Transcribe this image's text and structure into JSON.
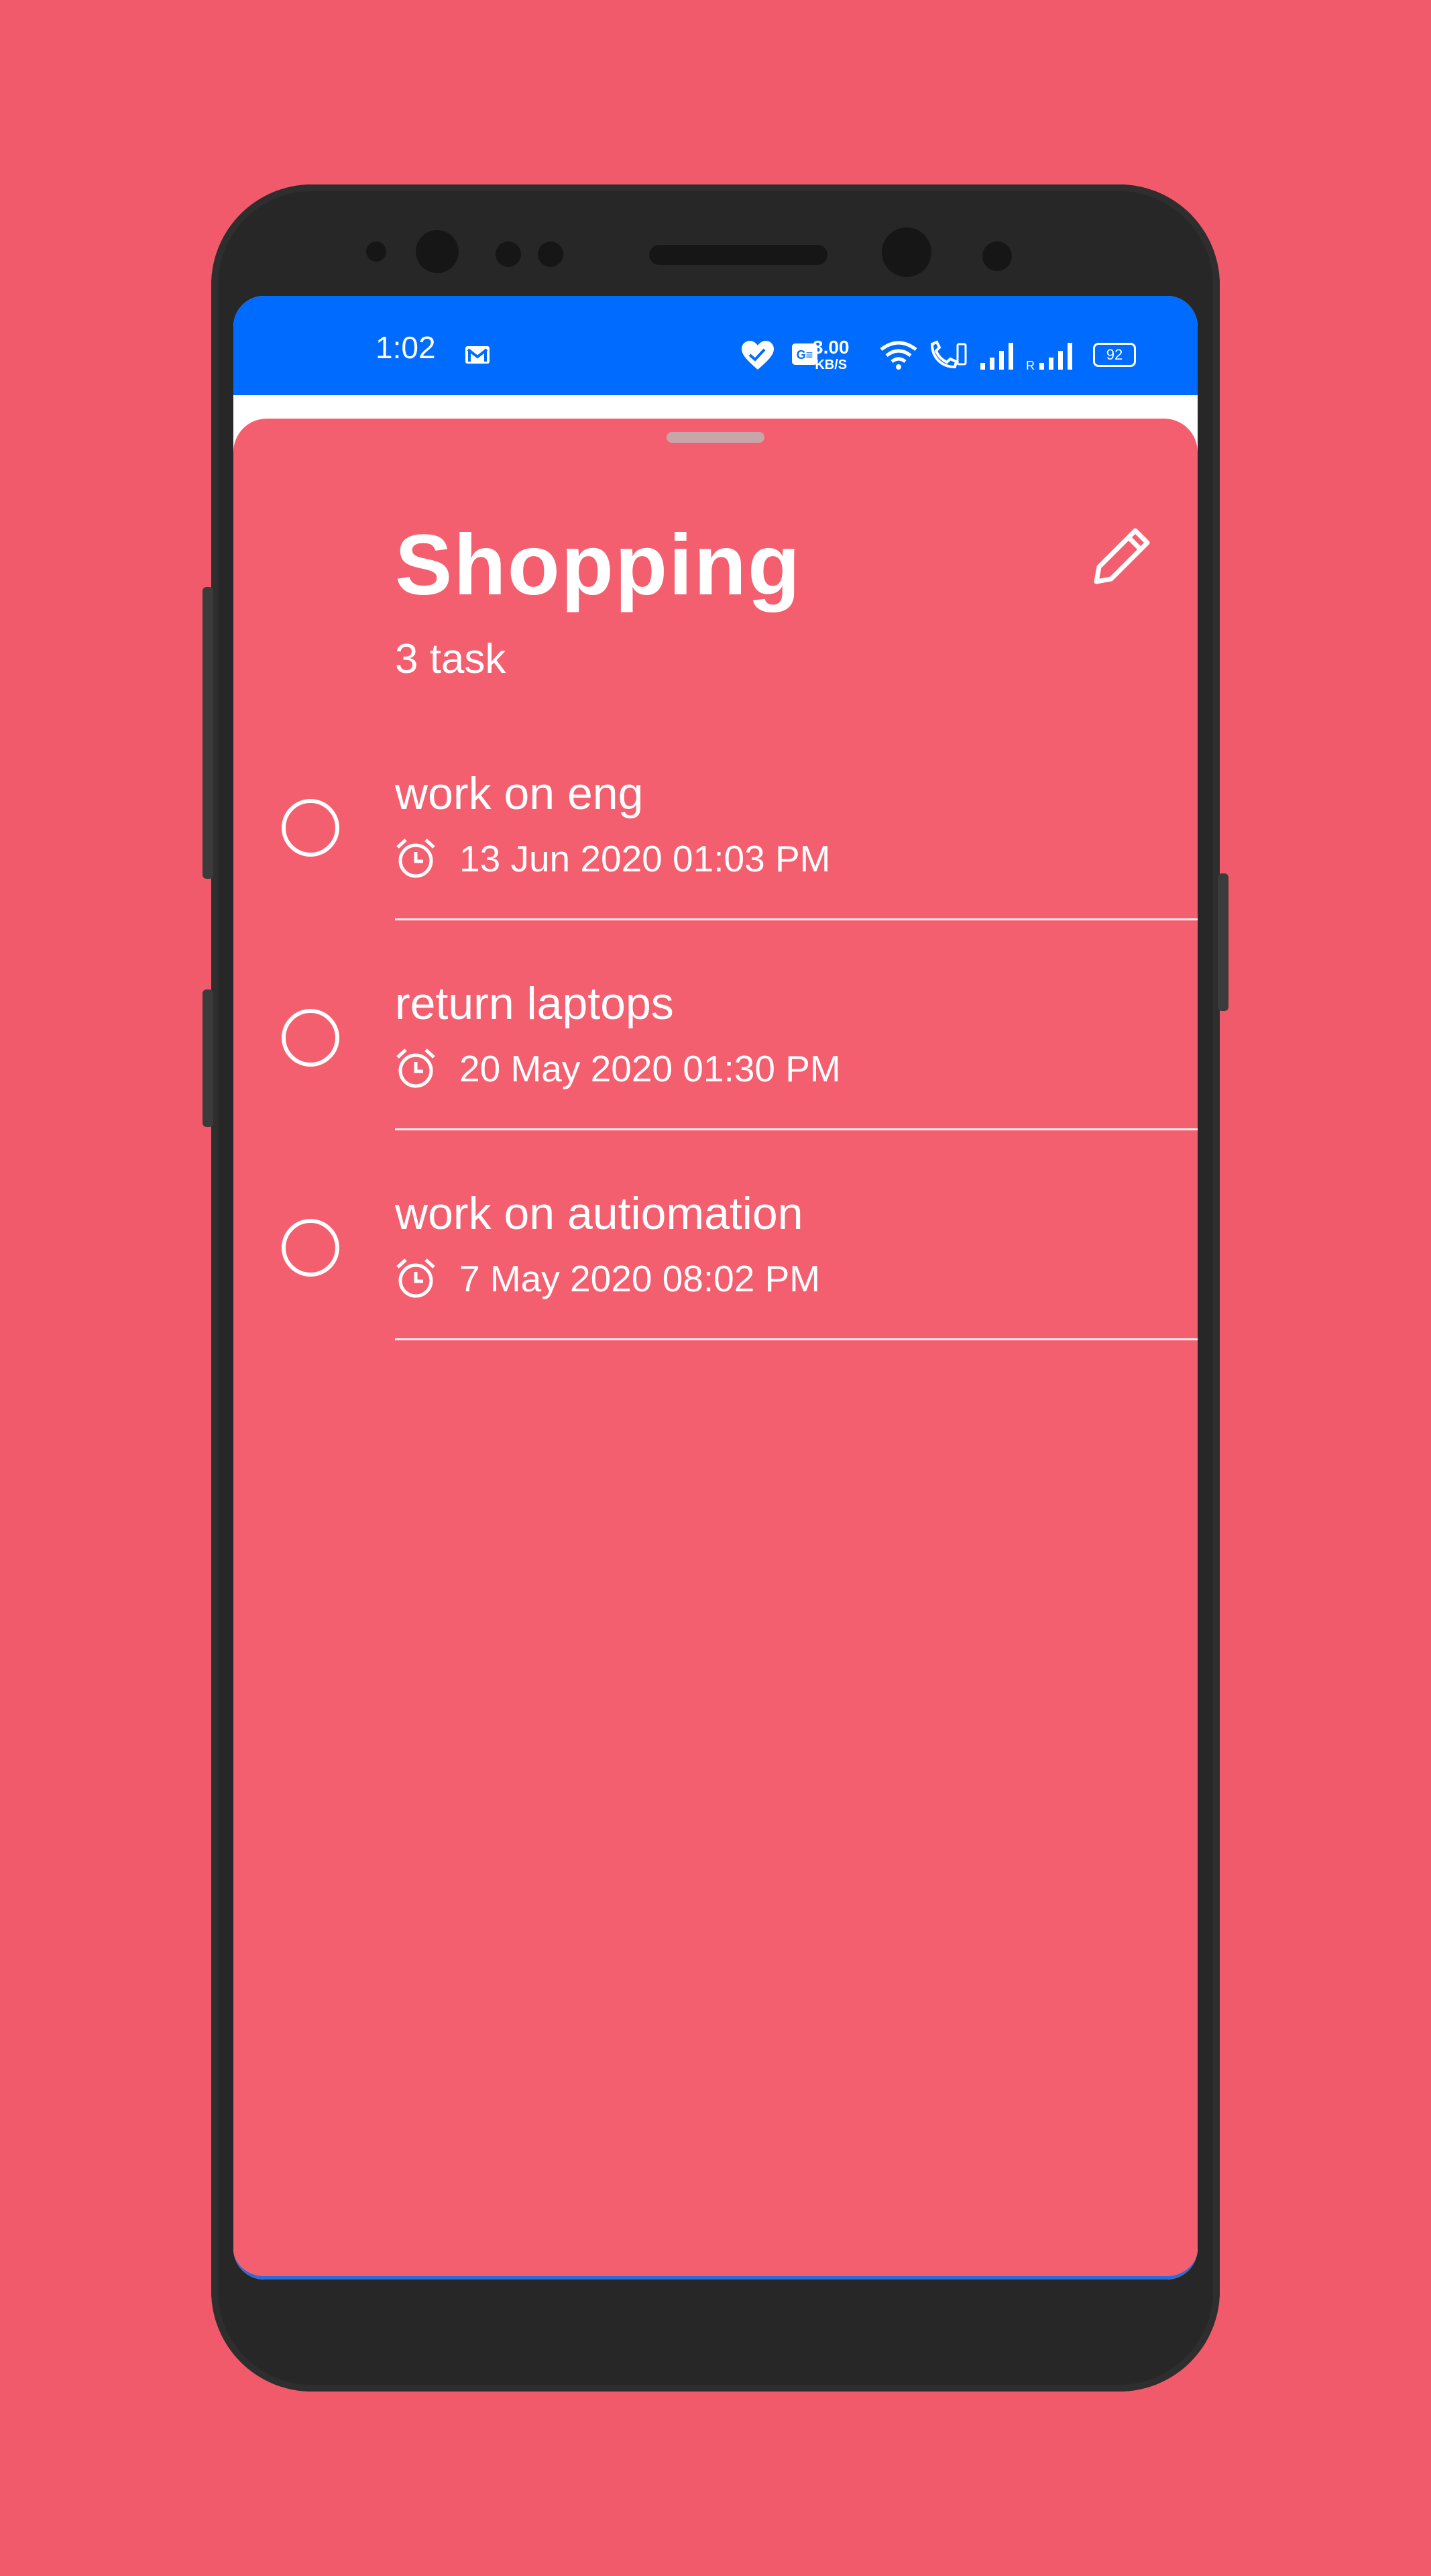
{
  "status_bar": {
    "time": "1:02",
    "net_speed_value": "3.00",
    "net_speed_unit": "KB/S",
    "battery": "92",
    "icons": [
      "gmail-icon",
      "health-icon",
      "sim-card-icon",
      "wifi-icon",
      "volte-call-icon",
      "signal-icon",
      "roaming-signal-icon",
      "battery-icon"
    ],
    "roaming_label": "R"
  },
  "sheet": {
    "title": "Shopping",
    "task_count": "3 task",
    "edit_icon": "pencil-icon"
  },
  "tasks": [
    {
      "name": "work on eng",
      "time": "13 Jun 2020 01:03 PM",
      "done": false
    },
    {
      "name": "return laptops",
      "time": "20 May 2020 01:30 PM",
      "done": false
    },
    {
      "name": "work on autiomation",
      "time": "7 May 2020 08:02 PM",
      "done": false
    }
  ],
  "colors": {
    "background": "#f05a6a",
    "sheet": "#f45f6f",
    "status_bar": "#006cff",
    "frame": "#272727"
  }
}
